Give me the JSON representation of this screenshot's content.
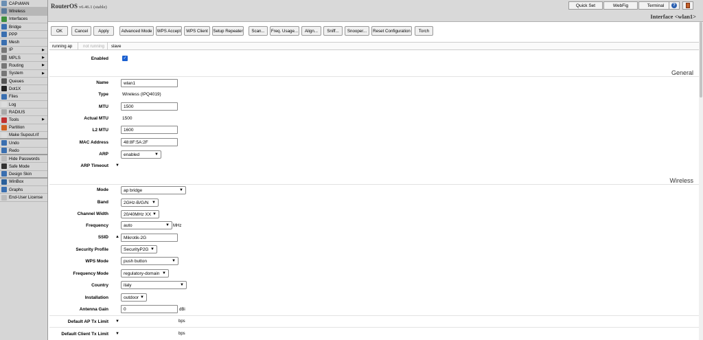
{
  "sidebar": {
    "items": [
      {
        "label": "CAPsMAN",
        "icon": "capsman-icon",
        "color": "#6b8fb3"
      },
      {
        "label": "Wireless",
        "icon": "wireless-icon",
        "color": "#5a7a9a",
        "selected": true
      },
      {
        "label": "Interfaces",
        "icon": "interfaces-icon",
        "color": "#3d8f3d"
      },
      {
        "label": "Bridge",
        "icon": "bridge-icon",
        "color": "#3a6fb0"
      },
      {
        "label": "PPP",
        "icon": "ppp-icon",
        "color": "#3a6fb0"
      },
      {
        "label": "Mesh",
        "icon": "mesh-icon",
        "color": "#3a6fb0"
      },
      {
        "label": "IP",
        "icon": "ip-icon",
        "color": "#777",
        "arrow": "▶"
      },
      {
        "label": "MPLS",
        "icon": "mpls-icon",
        "color": "#777",
        "arrow": "▶"
      },
      {
        "label": "Routing",
        "icon": "routing-icon",
        "color": "#777",
        "arrow": "▶"
      },
      {
        "label": "System",
        "icon": "system-icon",
        "color": "#777",
        "arrow": "▶"
      },
      {
        "label": "Queues",
        "icon": "queues-icon",
        "color": "#555"
      },
      {
        "label": "Dot1X",
        "icon": "dot1x-icon",
        "color": "#222"
      },
      {
        "label": "Files",
        "icon": "files-icon",
        "color": "#3a6fb0"
      },
      {
        "label": "Log",
        "icon": "log-icon",
        "color": "#ddd"
      },
      {
        "label": "RADIUS",
        "icon": "radius-icon",
        "color": "#aaa"
      },
      {
        "label": "Tools",
        "icon": "tools-icon",
        "color": "#c03030",
        "arrow": "▶"
      },
      {
        "label": "Partition",
        "icon": "partition-icon",
        "color": "#d06020"
      },
      {
        "label": "Make Supout.rif",
        "icon": "supout-icon",
        "color": "#ddd"
      },
      {
        "label": "Undo",
        "icon": "undo-icon",
        "color": "#3a6fb0"
      },
      {
        "label": "Redo",
        "icon": "redo-icon",
        "color": "#3a6fb0"
      },
      {
        "label": "Hide Passwords",
        "icon": "hide-passwords-icon",
        "color": "#bbb"
      },
      {
        "label": "Safe Mode",
        "icon": "safe-mode-icon",
        "color": "#333"
      },
      {
        "label": "Design Skin",
        "icon": "design-skin-icon",
        "color": "#3a6fb0"
      },
      {
        "label": "WinBox",
        "icon": "winbox-icon",
        "color": "#2a5f9a"
      },
      {
        "label": "Graphs",
        "icon": "graphs-icon",
        "color": "#3a6fb0"
      },
      {
        "label": "End-User License",
        "icon": "license-icon",
        "color": "#bbb"
      }
    ]
  },
  "header": {
    "brand": "RouterOS",
    "version": "v6.46.1 (stable)",
    "quick_set": "Quick Set",
    "webfig": "WebFig",
    "terminal": "Terminal",
    "help_icon": "help-icon",
    "save_icon": "save-icon",
    "title": "Interface <wlan1>"
  },
  "toolbar": {
    "buttons": [
      "OK",
      "Cancel",
      "Apply",
      "Advanced Mode",
      "WPS Accept",
      "WPS Client",
      "Setup Repeater",
      "Scan...",
      "Freq. Usage...",
      "Align...",
      "Sniff...",
      "Snooper...",
      "Reset Configuration",
      "Torch"
    ]
  },
  "status": {
    "running": "running ap",
    "not_running": "not running",
    "slave": "slave"
  },
  "form": {
    "enabled_label": "Enabled",
    "general_header": "General",
    "name_label": "Name",
    "name_value": "wlan1",
    "type_label": "Type",
    "type_value": "Wireless (IPQ4019)",
    "mtu_label": "MTU",
    "mtu_value": "1500",
    "actual_mtu_label": "Actual MTU",
    "actual_mtu_value": "1500",
    "l2mtu_label": "L2 MTU",
    "l2mtu_value": "1600",
    "mac_label": "MAC Address",
    "mac_value": "48:8F:5A:2F",
    "arp_label": "ARP",
    "arp_value": "enabled",
    "arp_timeout_label": "ARP Timeout",
    "wireless_header": "Wireless",
    "mode_label": "Mode",
    "mode_value": "ap bridge",
    "band_label": "Band",
    "band_value": "2GHz-B/G/N",
    "channel_width_label": "Channel Width",
    "channel_width_value": "20/40MHz XX",
    "frequency_label": "Frequency",
    "frequency_value": "auto",
    "frequency_unit": "MHz",
    "ssid_label": "SSID",
    "ssid_value": "Mikrotik-2G",
    "security_label": "Security Profile",
    "security_value": "SecurityP2G",
    "wps_label": "WPS Mode",
    "wps_value": "push button",
    "freq_mode_label": "Frequency Mode",
    "freq_mode_value": "regulatory-domain",
    "country_label": "Country",
    "country_value": "italy",
    "installation_label": "Installation",
    "installation_value": "outdoor",
    "antenna_label": "Antenna Gain",
    "antenna_value": "0",
    "antenna_unit": "dBi",
    "ap_tx_label": "Default AP Tx Limit",
    "ap_tx_unit": "bps",
    "client_tx_label": "Default Client Tx Limit",
    "client_tx_unit": "bps"
  },
  "colors": {
    "checkbox": "#1a5fd0"
  }
}
